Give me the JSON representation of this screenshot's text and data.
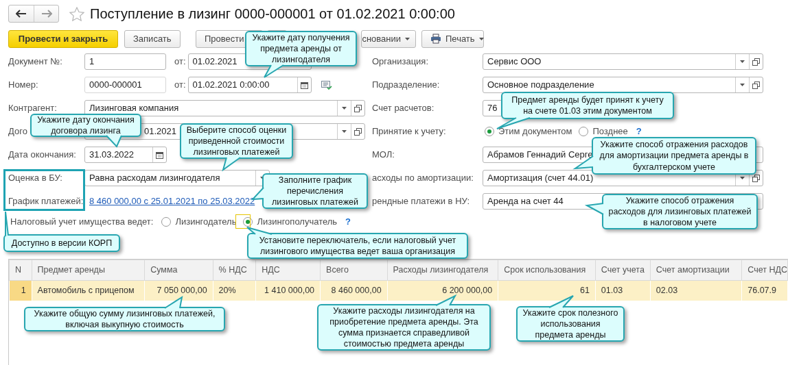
{
  "window": {
    "title": "Поступление в лизинг 0000-000001 от 01.02.2021 0:00:00",
    "favorite": false
  },
  "toolbar": [
    {
      "kind": "primary",
      "label": "Провести и закрыть"
    },
    {
      "kind": "plain",
      "label": "Записать"
    },
    {
      "kind": "plain",
      "label": "Провести"
    },
    {
      "kind": "blank"
    },
    {
      "kind": "menu",
      "label": "сновании"
    },
    {
      "kind": "print",
      "label": "Печать"
    }
  ],
  "form_rows": [
    {
      "left": [
        {
          "kind": "label",
          "text": "Документ №:"
        },
        {
          "kind": "input",
          "value": "1"
        },
        {
          "kind": "label",
          "text": "от:"
        },
        {
          "kind": "input",
          "value": "01.02.2021"
        }
      ],
      "right": [
        {
          "kind": "label",
          "text": "Организация:"
        },
        {
          "kind": "input",
          "value": "Сервис  ООО",
          "dropdown": true,
          "open": true
        }
      ]
    },
    {
      "left": [
        {
          "kind": "label",
          "text": "Номер:"
        },
        {
          "kind": "input",
          "value": "0000-000001",
          "readonly": true
        },
        {
          "kind": "label",
          "text": "от:"
        },
        {
          "kind": "input",
          "value": "01.02.2021  0:00:00",
          "calendar": true
        },
        {
          "kind": "icon"
        }
      ],
      "right": [
        {
          "kind": "label",
          "text": "Подразделение:"
        },
        {
          "kind": "input",
          "value": "Основное подразделение",
          "dropdown": true,
          "open": true
        }
      ]
    },
    {
      "left": [
        {
          "kind": "label",
          "text": "Контрагент:"
        },
        {
          "kind": "input",
          "value": "Лизинговая компания",
          "dropdown": true,
          "open": true
        }
      ],
      "right": [
        {
          "kind": "label",
          "text": "Счет расчетов:"
        },
        {
          "kind": "input",
          "value": "76"
        }
      ]
    },
    {
      "left": [
        {
          "kind": "label",
          "text": "Дого"
        },
        {
          "kind": "input",
          "value": "01.2021",
          "dropdown": true,
          "open": true
        }
      ],
      "right": [
        {
          "kind": "label",
          "text": "Принятие к учету:"
        },
        {
          "kind": "radio",
          "label": "Этим документом",
          "selected": true
        },
        {
          "kind": "radio",
          "label": "Позднее",
          "selected": false
        },
        {
          "kind": "help",
          "text": "?"
        }
      ]
    },
    {
      "left": [
        {
          "kind": "label",
          "text": "Дата окончания:"
        },
        {
          "kind": "input",
          "value": "31.03.2022",
          "calendar": true
        }
      ],
      "right": [
        {
          "kind": "label",
          "text": "МОЛ:"
        },
        {
          "kind": "input",
          "value": "Абрамов Геннадий Серге"
        }
      ]
    },
    {
      "left": [
        {
          "kind": "label",
          "text": "Оценка в БУ:"
        },
        {
          "kind": "input",
          "value": "Равна расходам лизингодателя",
          "dropdown": true
        }
      ],
      "right": [
        {
          "kind": "label",
          "text": "асходы по амортизации:"
        },
        {
          "kind": "input",
          "value": "Амортизация (счет 44.01)",
          "dropdown": true,
          "open": true
        }
      ]
    },
    {
      "left": [
        {
          "kind": "label",
          "text": "График платежей:"
        },
        {
          "kind": "link",
          "text": "8 460 000,00 с 25.01.2021 по 25.03.2022"
        }
      ],
      "right": [
        {
          "kind": "label",
          "text": "рендные платежи в НУ:"
        },
        {
          "kind": "input",
          "value": "Аренда на счет 44"
        }
      ]
    },
    {
      "left": [
        {
          "kind": "label",
          "text": "Налоговый учет имущества ведет:"
        },
        {
          "kind": "radio",
          "label": "Лизингодатель",
          "selected": false
        },
        {
          "kind": "radio",
          "label": "Лизингополучатель",
          "selected": true
        },
        {
          "kind": "help",
          "text": "?"
        }
      ],
      "right": []
    }
  ],
  "table": {
    "columns": [
      "N",
      "Предмет аренды",
      "Сумма",
      "% НДС",
      "НДС",
      "Всего",
      "Расходы лизингодателя",
      "Срок использования",
      "Счет учета",
      "Счет амортизации",
      "Счет НДС"
    ],
    "rows": [
      {
        "selected": true,
        "cells": [
          "1",
          "Автомобиль с прицепом",
          "7 050 000,00",
          "20%",
          "1 410 000,00",
          "8 460 000,00",
          "6 200 000,00",
          "61",
          "01.03",
          "02.03",
          "76.07.9"
        ]
      }
    ]
  },
  "frames": [
    {
      "kind": "outline"
    },
    {
      "kind": "highlight"
    }
  ],
  "callouts": [
    {
      "text": "Укажите дату получения предмета аренды от лизингодателя"
    },
    {
      "text": "Предмет аренды будет принят к учету на счете 01.03 этим документом"
    },
    {
      "text": "Укажите дату окончания договора лизинга"
    },
    {
      "text": "Выберите способ оценки приведенной стоимости лизинговых платежей"
    },
    {
      "text": "Заполните график перечисления лизинговых платежей"
    },
    {
      "text": "Укажите способ отражения расходов для амортизации предмета аренды в бухгалтерском учете"
    },
    {
      "text": "Укажите способ отражения расходов для лизинговых платежей в налоговом учете"
    },
    {
      "text": "Доступно в версии КОРП"
    },
    {
      "text": "Установите переключатель, если налоговый учет лизингового имущества ведет ваша организация"
    },
    {
      "text": "Укажите общую сумму лизинговых платежей, включая выкупную стоимость"
    },
    {
      "text": "Укажите расходы лизингодателя на приобретение предмета аренды. Эта сумма признается справедливой стоимостью предмета аренды"
    },
    {
      "text": "Укажите срок полезного использования предмета аренды"
    }
  ]
}
